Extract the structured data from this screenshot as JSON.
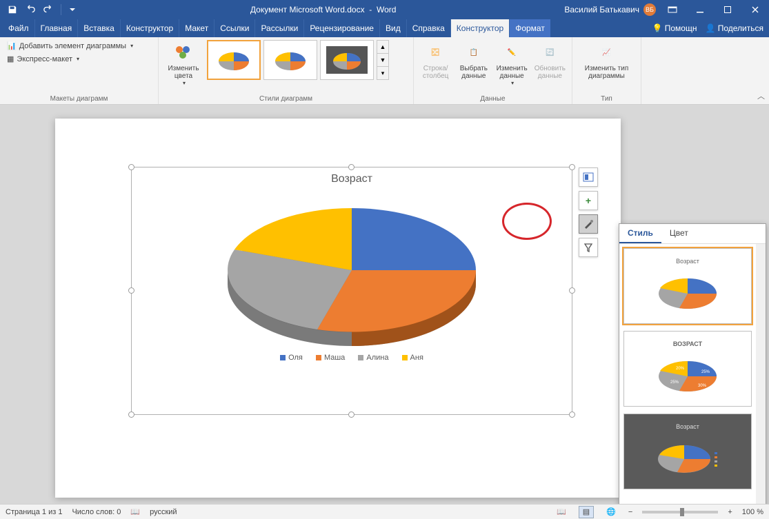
{
  "title": {
    "doc": "Документ Microsoft Word.docx",
    "app": "Word"
  },
  "user": {
    "name": "Василий Батькавич",
    "initials": "ВБ"
  },
  "tabs": {
    "file": "Файл",
    "home": "Главная",
    "insert": "Вставка",
    "design_tab": "Конструктор",
    "layout": "Макет",
    "references": "Ссылки",
    "mailings": "Рассылки",
    "review": "Рецензирование",
    "view": "Вид",
    "help": "Справка",
    "chart_design": "Конструктор",
    "chart_format": "Формат",
    "assist": "Помощн",
    "share": "Поделиться"
  },
  "ribbon": {
    "layouts_group": "Макеты диаграмм",
    "add_element": "Добавить элемент диаграммы",
    "express_layout": "Экспресс-макет",
    "change_colors": "Изменить цвета",
    "styles_group": "Стили диаграмм",
    "data_group": "Данные",
    "row_col": "Строка/\nстолбец",
    "select_data": "Выбрать\nданные",
    "edit_data": "Изменить\nданные",
    "refresh_data": "Обновить\nданные",
    "type_group": "Тип",
    "change_type": "Изменить тип\nдиаграммы"
  },
  "chart_data": {
    "type": "pie",
    "title": "Возраст",
    "categories": [
      "Оля",
      "Маша",
      "Алина",
      "Аня"
    ],
    "values": [
      25,
      30,
      25,
      20
    ],
    "colors": [
      "#4472c4",
      "#ed7d31",
      "#a5a5a5",
      "#ffc000"
    ]
  },
  "style_pane": {
    "tab_style": "Стиль",
    "tab_color": "Цвет",
    "thumb_title": "Возраст",
    "thumb_title_caps": "ВОЗРАСТ"
  },
  "status": {
    "page": "Страница 1 из 1",
    "words": "Число слов: 0",
    "lang": "русский",
    "zoom": "100 %"
  }
}
